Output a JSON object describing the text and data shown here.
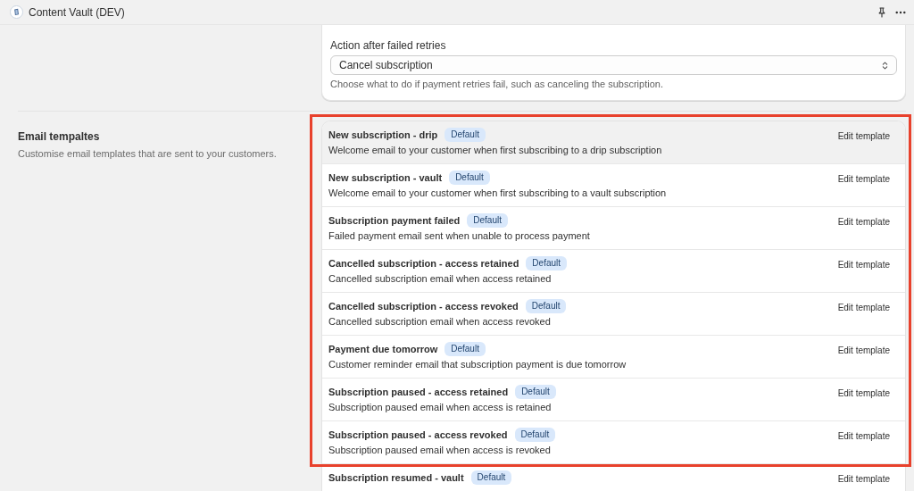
{
  "app_bar": {
    "title": "Content Vault (DEV)"
  },
  "retry_settings": {
    "label": "Action after failed retries",
    "select": {
      "value": "Cancel subscription"
    },
    "help": "Choose what to do if payment retries fail, such as canceling the subscription."
  },
  "email_templates": {
    "title": "Email tempaltes",
    "description": "Customise email templates that are sent to your customers.",
    "template_groups": [
      {
        "highlighted": true,
        "templates": [
          {
            "title": "New subscription - drip",
            "badge": "Default",
            "description": "Welcome email to your customer when first subscribing to a drip subscription",
            "action": "Edit template",
            "hovered": true
          },
          {
            "title": "New subscription - vault",
            "badge": "Default",
            "description": "Welcome email to your customer when first subscribing to a vault subscription",
            "action": "Edit template",
            "hovered": false
          },
          {
            "title": "Subscription payment failed",
            "badge": "Default",
            "description": "Failed payment email sent when unable to process payment",
            "action": "Edit template",
            "hovered": false
          },
          {
            "title": "Cancelled subscription - access retained",
            "badge": "Default",
            "description": "Cancelled subscription email when access retained",
            "action": "Edit template",
            "hovered": false
          },
          {
            "title": "Cancelled subscription - access revoked",
            "badge": "Default",
            "description": "Cancelled subscription email when access revoked",
            "action": "Edit template",
            "hovered": false
          },
          {
            "title": "Payment due tomorrow",
            "badge": "Default",
            "description": "Customer reminder email that subscription payment is due tomorrow",
            "action": "Edit template",
            "hovered": false
          },
          {
            "title": "Subscription paused - access retained",
            "badge": "Default",
            "description": "Subscription paused email when access is retained",
            "action": "Edit template",
            "hovered": false
          },
          {
            "title": "Subscription paused - access revoked",
            "badge": "Default",
            "description": "Subscription paused email when access is revoked",
            "action": "Edit template",
            "hovered": false
          }
        ]
      },
      {
        "templates": [
          {
            "title": "Subscription resumed - vault",
            "badge": "Default",
            "action": "Edit template",
            "hovered": false
          }
        ]
      }
    ]
  }
}
